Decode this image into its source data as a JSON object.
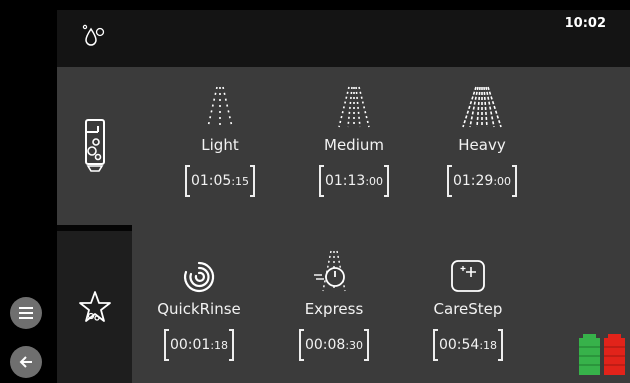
{
  "status": {
    "clock": "10:02"
  },
  "programs": [
    {
      "name": "Light",
      "time_main": "01:05",
      "time_sec": ":15",
      "icon": "spray-light-icon"
    },
    {
      "name": "Medium",
      "time_main": "01:13",
      "time_sec": ":00",
      "icon": "spray-medium-icon"
    },
    {
      "name": "Heavy",
      "time_main": "01:29",
      "time_sec": ":00",
      "icon": "spray-heavy-icon"
    },
    {
      "name": "QuickRinse",
      "time_main": "00:01",
      "time_sec": ":18",
      "icon": "swirl-icon"
    },
    {
      "name": "Express",
      "time_main": "00:08",
      "time_sec": ":30",
      "icon": "express-timer-icon"
    },
    {
      "name": "CareStep",
      "time_main": "00:54",
      "time_sec": ":18",
      "icon": "sparkle-box-icon"
    }
  ],
  "colors": {
    "accent_green": "#37b24a",
    "accent_red": "#e2231a"
  }
}
